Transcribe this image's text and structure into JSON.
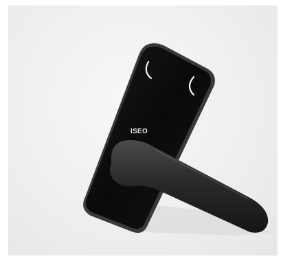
{
  "product": {
    "brand_label": "ISEO",
    "subject": "electronic-door-lock-with-lever-handle"
  },
  "colors": {
    "background": "#efefef",
    "plate": "#0b0b0c",
    "plate_edge": "#3a3a3c",
    "handle": "#2a2a2c",
    "reader_arcs": "#f2f2f2"
  }
}
